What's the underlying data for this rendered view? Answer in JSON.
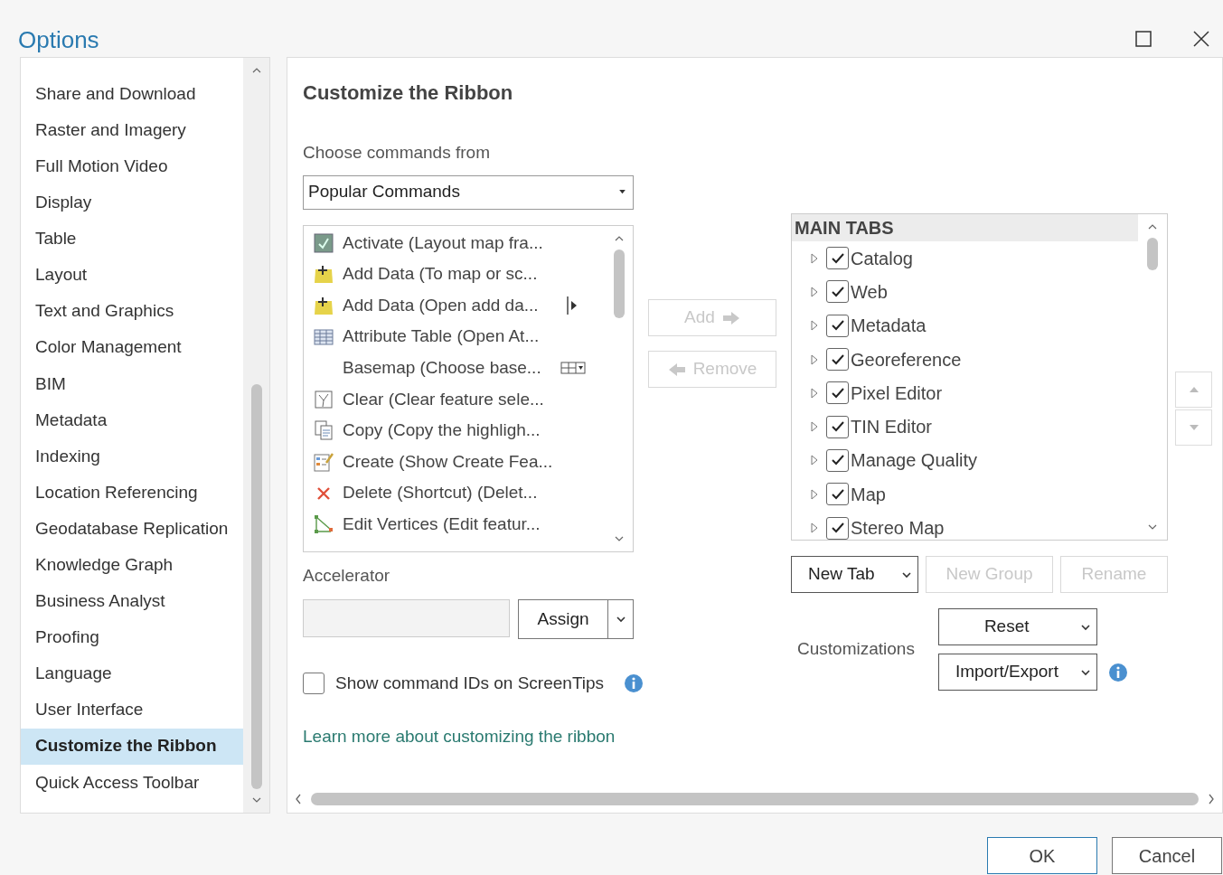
{
  "window": {
    "title": "Options"
  },
  "sidebar": {
    "items": [
      {
        "label": "Share and Download",
        "selected": false
      },
      {
        "label": "Raster and Imagery",
        "selected": false
      },
      {
        "label": "Full Motion Video",
        "selected": false
      },
      {
        "label": "Display",
        "selected": false
      },
      {
        "label": "Table",
        "selected": false
      },
      {
        "label": "Layout",
        "selected": false
      },
      {
        "label": "Text and Graphics",
        "selected": false
      },
      {
        "label": "Color Management",
        "selected": false
      },
      {
        "label": "BIM",
        "selected": false
      },
      {
        "label": "Metadata",
        "selected": false
      },
      {
        "label": "Indexing",
        "selected": false
      },
      {
        "label": "Location Referencing",
        "selected": false
      },
      {
        "label": "Geodatabase Replication",
        "selected": false
      },
      {
        "label": "Knowledge Graph",
        "selected": false
      },
      {
        "label": "Business Analyst",
        "selected": false
      },
      {
        "label": "Proofing",
        "selected": false
      },
      {
        "label": "Language",
        "selected": false
      },
      {
        "label": "User Interface",
        "selected": false
      },
      {
        "label": "Customize the Ribbon",
        "selected": true
      },
      {
        "label": "Quick Access Toolbar",
        "selected": false
      }
    ]
  },
  "page": {
    "title": "Customize the Ribbon",
    "commands_from": {
      "label": "Choose commands from",
      "value": "Popular Commands"
    },
    "commands": [
      {
        "label": "Activate (Layout map fra...",
        "kind": "activate"
      },
      {
        "label": "Add Data (To map or sc...",
        "kind": "add"
      },
      {
        "label": "Add Data (Open add da...",
        "kind": "add-split"
      },
      {
        "label": "Attribute Table (Open At...",
        "kind": "table"
      },
      {
        "label": "Basemap (Choose base...",
        "kind": "gallery"
      },
      {
        "label": "Clear (Clear feature sele...",
        "kind": "clear"
      },
      {
        "label": "Copy (Copy the highligh...",
        "kind": "copy"
      },
      {
        "label": "Create (Show Create Fea...",
        "kind": "create"
      },
      {
        "label": "Delete (Shortcut) (Delet...",
        "kind": "delete"
      },
      {
        "label": "Edit Vertices (Edit featur...",
        "kind": "vertices"
      }
    ],
    "add_button": {
      "label": "Add",
      "disabled": true
    },
    "remove_button": {
      "label": "Remove",
      "disabled": true
    },
    "main_tabs": {
      "header": "MAIN TABS",
      "items": [
        {
          "label": "Catalog",
          "checked": true
        },
        {
          "label": "Web",
          "checked": true
        },
        {
          "label": "Metadata",
          "checked": true
        },
        {
          "label": "Georeference",
          "checked": true
        },
        {
          "label": "Pixel Editor",
          "checked": true
        },
        {
          "label": "TIN Editor",
          "checked": true
        },
        {
          "label": "Manage Quality",
          "checked": true
        },
        {
          "label": "Map",
          "checked": true
        },
        {
          "label": "Stereo Map",
          "checked": true
        }
      ]
    },
    "accelerator": {
      "label": "Accelerator",
      "assign": "Assign"
    },
    "new_tab": {
      "label": "New Tab"
    },
    "new_group": {
      "label": "New Group",
      "disabled": true
    },
    "rename": {
      "label": "Rename",
      "disabled": true
    },
    "customizations": {
      "label": "Customizations",
      "reset": "Reset",
      "import_export": "Import/Export"
    },
    "show_ids": {
      "label": "Show command IDs on ScreenTips",
      "checked": false
    },
    "link": "Learn more about customizing the ribbon"
  },
  "buttons": [
    {
      "label": "OK",
      "kind": "primary"
    },
    {
      "label": "Cancel",
      "kind": "normal"
    }
  ]
}
